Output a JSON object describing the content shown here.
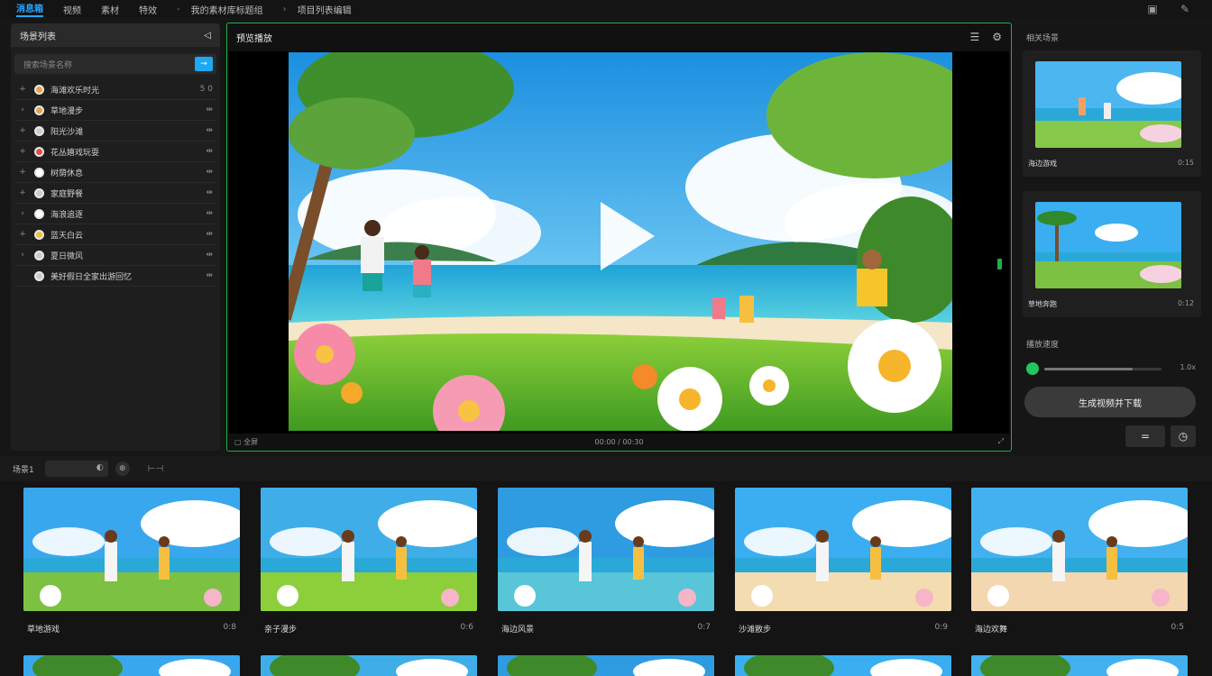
{
  "colors": {
    "accent_blue": "#25a7ff",
    "accent_green": "#1fae4b",
    "slider_green": "#22c55e"
  },
  "topbar": {
    "items": [
      "消息箱",
      "视频",
      "素材",
      "特效"
    ],
    "breadcrumb": [
      "我的素材库标题组",
      "项目列表编辑"
    ]
  },
  "left_panel": {
    "title": "场景列表",
    "search_placeholder": "搜索场景名称",
    "search_button": "→",
    "rows": [
      {
        "label": "海滩欢乐时光",
        "expander": "+",
        "tail": "5 0",
        "dot": "#e8a24a"
      },
      {
        "label": "草地漫步",
        "expander": "›",
        "tail": "⇹",
        "dot": "#e8a24a"
      },
      {
        "label": "阳光沙滩",
        "expander": "+",
        "tail": "⇹",
        "dot": "#cccccc"
      },
      {
        "label": "花丛嬉戏玩耍",
        "expander": "+",
        "tail": "⇹",
        "dot": "#e05050"
      },
      {
        "label": "树荫休息",
        "expander": "+",
        "tail": "⇹",
        "dot": "#ffffff"
      },
      {
        "label": "家庭野餐",
        "expander": "+",
        "tail": "⇹",
        "dot": "#cccccc"
      },
      {
        "label": "海浪追逐",
        "expander": "›",
        "tail": "⇹",
        "dot": "#ffffff"
      },
      {
        "label": "蓝天白云",
        "expander": "+",
        "tail": "⇹",
        "dot": "#f0c040"
      },
      {
        "label": "夏日微风",
        "expander": "›",
        "tail": "⇹",
        "dot": "#cccccc"
      },
      {
        "label": "美好假日全家出游回忆",
        "expander": "",
        "tail": "⇹",
        "dot": "#cccccc"
      }
    ]
  },
  "preview": {
    "title": "预览播放",
    "footer_left": "全屏",
    "footer_center": "00:00 / 00:30",
    "footer_right": "⤢"
  },
  "right_panel": {
    "title": "相关场景",
    "cards": [
      {
        "label": "海边游戏",
        "time": "0:15"
      },
      {
        "label": "草地奔跑",
        "time": "0:12"
      }
    ],
    "speed_title": "播放速度",
    "speed_value": "1.0x",
    "speed_fraction": 0.75,
    "action_button": "生成视频并下载",
    "btn_list": "=",
    "btn_clock": "◷"
  },
  "bottom_bar": {
    "label": "场景1",
    "input_value": "",
    "icon_a": "◐",
    "icon_b": "⊕",
    "icon_c": "⊢⊣"
  },
  "gallery": [
    {
      "label": "草地游戏",
      "time": "0:8"
    },
    {
      "label": "亲子漫步",
      "time": "0:6"
    },
    {
      "label": "海边风景",
      "time": "0:7"
    },
    {
      "label": "沙滩散步",
      "time": "0:9"
    },
    {
      "label": "海边欢舞",
      "time": "0:5"
    }
  ]
}
